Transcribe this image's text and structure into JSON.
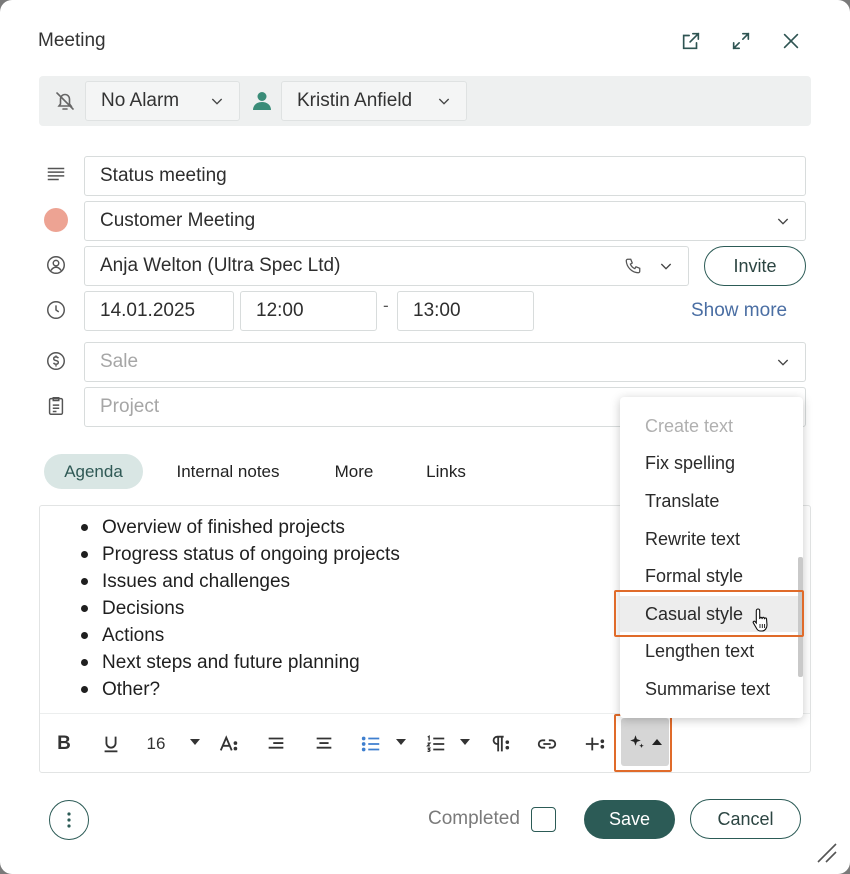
{
  "dialog": {
    "title": "Meeting"
  },
  "topbar": {
    "alarm": "No Alarm",
    "owner": "Kristin Anfield"
  },
  "form": {
    "subject": "Status meeting",
    "category": "Customer Meeting",
    "category_color": "#eda393",
    "contact": "Anja Welton (Ultra Spec Ltd)",
    "invite_label": "Invite",
    "date": "14.01.2025",
    "start_time": "12:00",
    "time_separator": "-",
    "end_time": "13:00",
    "show_more_label": "Show more",
    "sale_placeholder": "Sale",
    "project_placeholder": "Project"
  },
  "tabs": [
    {
      "label": "Agenda",
      "active": true
    },
    {
      "label": "Internal notes",
      "active": false
    },
    {
      "label": "More",
      "active": false
    },
    {
      "label": "Links",
      "active": false
    }
  ],
  "editor": {
    "items": [
      "Overview of finished projects",
      "Progress status of ongoing projects",
      "Issues and challenges",
      "Decisions",
      "Actions",
      "Next steps and future planning",
      "Other?"
    ]
  },
  "toolbar": {
    "font_size": "16"
  },
  "ai_menu": {
    "items": [
      {
        "label": "Create text",
        "disabled": true
      },
      {
        "label": "Fix spelling"
      },
      {
        "label": "Translate"
      },
      {
        "label": "Rewrite text"
      },
      {
        "label": "Formal style"
      },
      {
        "label": "Casual style",
        "hovered": true
      },
      {
        "label": "Lengthen text"
      },
      {
        "label": "Summarise text"
      }
    ]
  },
  "footer": {
    "completed_label": "Completed",
    "save_label": "Save",
    "cancel_label": "Cancel"
  },
  "colors": {
    "primary": "#2c5b56",
    "accent_link": "#4a6ea3",
    "highlight": "#e06b2a"
  }
}
